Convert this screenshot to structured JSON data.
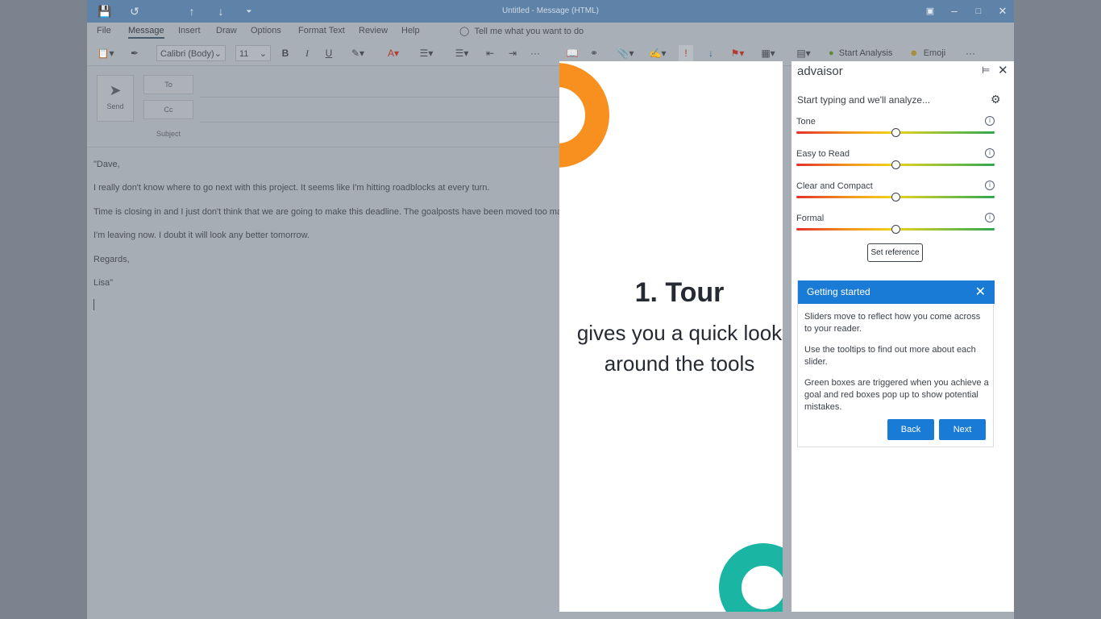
{
  "window": {
    "title": "Untitled  -  Message (HTML)",
    "controls": [
      "restore-ribbon",
      "minimize",
      "maximize",
      "close"
    ]
  },
  "menu": {
    "items": [
      "File",
      "Message",
      "Insert",
      "Draw",
      "Options",
      "Format Text",
      "Review",
      "Help"
    ],
    "active": "Message",
    "tell_me": "Tell me what you want to do"
  },
  "ribbon": {
    "font_name": "Calibri (Body)",
    "font_size": "11",
    "bold": "B",
    "italic": "I",
    "underline": "U",
    "start_analysis": "Start Analysis",
    "emoji": "Emoji",
    "more": "···"
  },
  "compose": {
    "send": "Send",
    "to": "To",
    "cc": "Cc",
    "subject": "Subject"
  },
  "message_body": [
    "\"Dave,",
    "I really don't know where to go next with this project. It seems like I'm hitting roadblocks at every turn.",
    "Time is closing in and I just don't think that we are going to make this deadline. The goalposts have been moved too many",
    "I'm leaving now. I doubt it will look any better tomorrow.",
    "Regards,",
    "Lisa\""
  ],
  "tour": {
    "heading": "1. Tour",
    "subtext": "gives you a quick look around the tools"
  },
  "panel": {
    "brand": "advaisor",
    "status": "Start typing and we'll analyze...",
    "sliders": [
      {
        "label": "Tone",
        "value": 0.5
      },
      {
        "label": "Easy to Read",
        "value": 0.5
      },
      {
        "label": "Clear and Compact",
        "value": 0.5
      },
      {
        "label": "Formal",
        "value": 0.5
      }
    ],
    "set_reference": "Set reference"
  },
  "getting_started": {
    "title": "Getting started",
    "paragraphs": [
      "Sliders move to reflect how you come across to your reader.",
      "Use the tooltips to find out more about each slider.",
      "Green boxes are triggered when you achieve a goal and red boxes pop up to show potential mistakes."
    ],
    "back": "Back",
    "next": "Next"
  },
  "colors": {
    "title_bar": "#5e82a8",
    "accent_blue": "#1a7bd6",
    "ring_orange": "#f7901e",
    "ring_green": "#1bb5a3"
  }
}
